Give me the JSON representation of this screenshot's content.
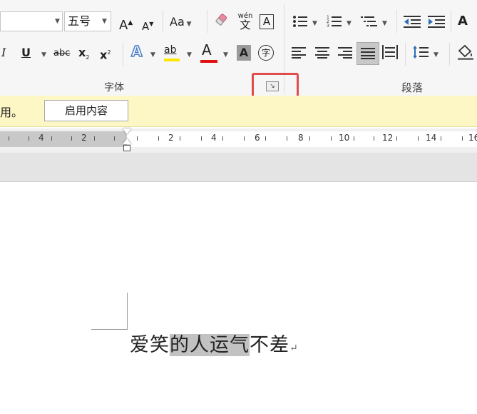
{
  "ribbon": {
    "font_size_value": "五号",
    "grow_font": "A",
    "shrink_font": "A",
    "change_case": "Aa",
    "phonetic_top": "wén",
    "phonetic_bottom": "文",
    "char_border": "A",
    "italic": "I",
    "underline": "U",
    "strikethrough": "abc",
    "subscript": "x",
    "subscript_mark": "2",
    "superscript": "x",
    "superscript_mark": "2",
    "text_effects": "A",
    "highlight": "ab",
    "font_color": "A",
    "char_shading": "A",
    "enclose_char": "字",
    "group_font_label": "字体",
    "group_paragraph_label": "段落",
    "partial_right_icon": "A"
  },
  "message_bar": {
    "text": "用。",
    "button_label": "启用内容"
  },
  "ruler": {
    "left_labels": [
      "4",
      "2"
    ],
    "right_labels": [
      "2",
      "4",
      "6",
      "8",
      "10",
      "12",
      "14",
      "16"
    ]
  },
  "document": {
    "pre": "爱笑",
    "selected": "的人运气",
    "post": "不差",
    "return_mark": "↵"
  },
  "colors": {
    "highlight_yellow": "#ffe600",
    "font_red": "#e01010",
    "callout_red": "#e14b4b",
    "text_effects_blue": "#4a7cc7"
  }
}
